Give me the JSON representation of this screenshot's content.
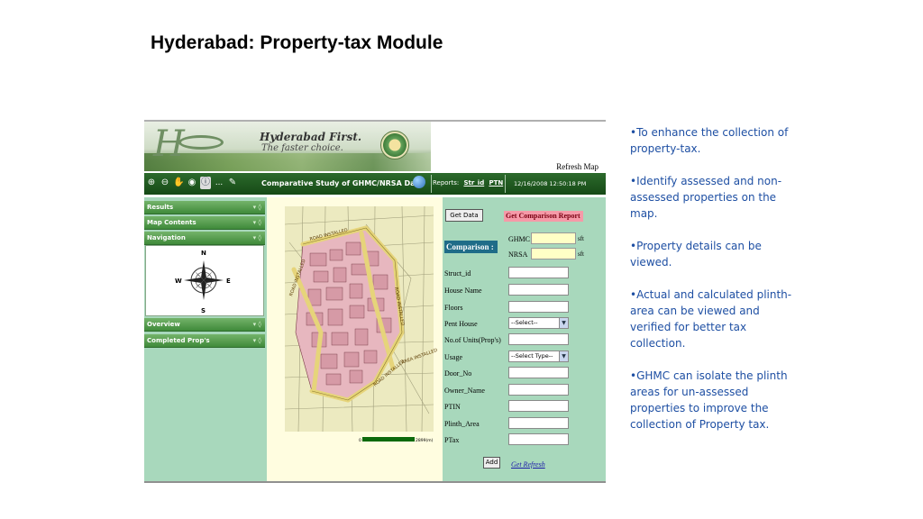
{
  "slide": {
    "title": "Hyderabad: Property-tax Module",
    "bullets": [
      "•To enhance the collection of property-tax.",
      "•Identify assessed and non-assessed properties on the map.",
      "•Property details can be viewed.",
      "•Actual and calculated plinth-area can be viewed and verified for better tax collection.",
      "•GHMC can isolate the plinth areas for un-assessed properties to improve the collection of Property tax."
    ]
  },
  "app": {
    "logo_letter": "H",
    "brand_line1": "Hyderabad First.",
    "brand_line2": "The faster choice.",
    "refresh_map": "Refresh Map",
    "toolbar": {
      "title": "Comparative Study of GHMC/NRSA Data",
      "reports_label": "Reports:",
      "report_link1": "Str_id",
      "report_link2": "PTN",
      "timestamp": "12/16/2008 12:50:18 PM",
      "more": "..."
    },
    "left_panel": {
      "results": "Results",
      "map_contents": "Map Contents",
      "navigation": "Navigation",
      "overview": "Overview",
      "completed": "Completed Prop's",
      "compass": {
        "n": "N",
        "s": "S",
        "e": "E",
        "w": "W"
      }
    },
    "map": {
      "scale_start": "0",
      "scale_end": "2899(m)",
      "road_labels": [
        "ROAD INSTALLED",
        "ROAD INSTALLED",
        "ROAD INSTALLED",
        "ROAD INSTALLED",
        "AREA INSTALLED"
      ]
    },
    "form": {
      "get_data": "Get Data",
      "get_report": "Get Comparison Report",
      "comparison": "Comparison :",
      "ghmc": "GHMC",
      "nrsa": "NRSA",
      "unit": "sft",
      "fields": {
        "struct_id": "Struct_id",
        "house_name": "House Name",
        "floors": "Floors",
        "pent_house": "Pent House",
        "units": "No.of Units(Prop's)",
        "usage": "Usage",
        "door_no": "Door_No",
        "owner_name": "Owner_Name",
        "ptin": "PTIN",
        "plinth_area": "Plinth_Area",
        "ptax": "PTax"
      },
      "pent_house_value": "--Select--",
      "usage_value": "--Select Type--",
      "add": "Add",
      "refresh": "Get Refresh"
    }
  }
}
